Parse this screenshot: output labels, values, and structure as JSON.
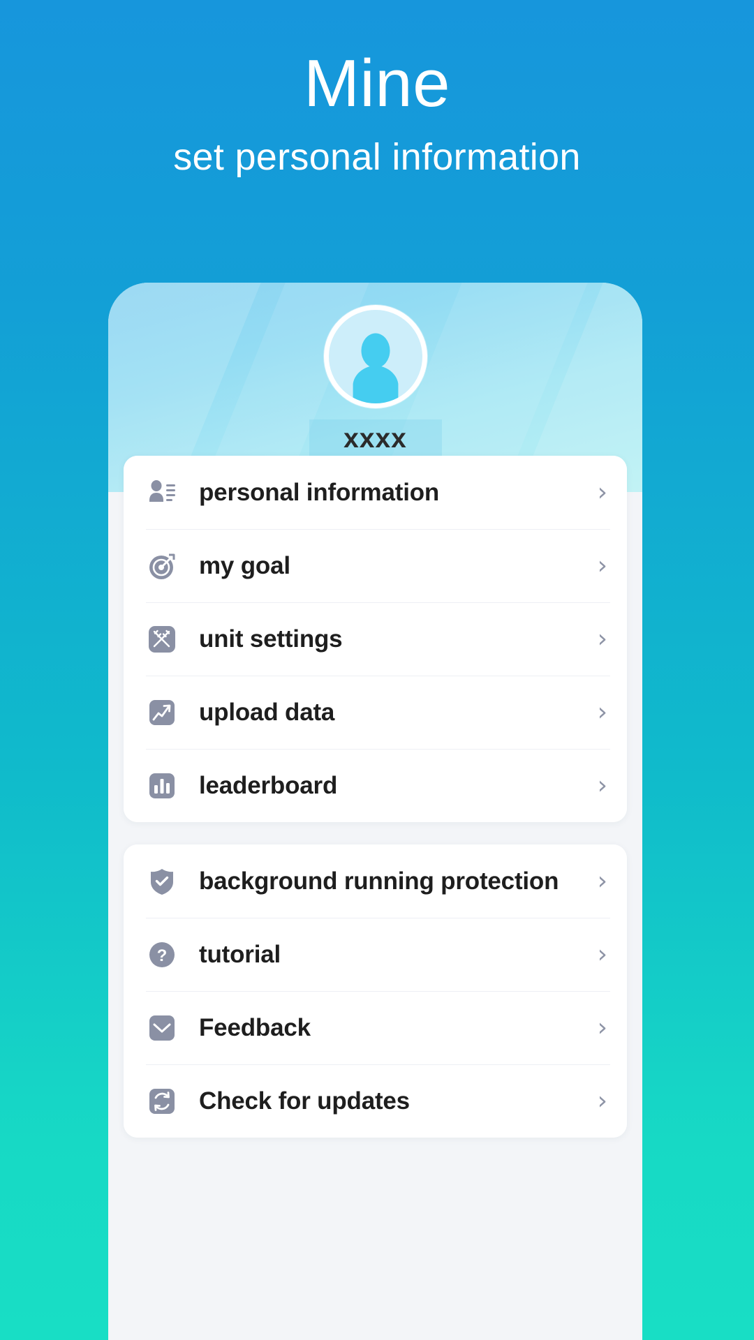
{
  "promo": {
    "title": "Mine",
    "subtitle": "set personal information"
  },
  "profile": {
    "username": "xxxx",
    "avatar_icon": "person-avatar-icon"
  },
  "colors": {
    "background_top": "#1796DC",
    "background_bottom": "#18DEC5",
    "hero_top": "#8CD3F2",
    "hero_bottom": "#B9F1F4",
    "icon_gray": "#8A90A4",
    "label_text": "#1e1e1e",
    "chevron": "#8E94A6",
    "card_background": "#FFFFFF",
    "phone_background": "#F3F5F8"
  },
  "menu_groups": [
    {
      "name": "primary",
      "items": [
        {
          "label": "personal information",
          "icon": "person-details-icon",
          "chevron": "›"
        },
        {
          "label": "my goal",
          "icon": "target-icon",
          "chevron": "›"
        },
        {
          "label": "unit settings",
          "icon": "rulers-icon",
          "chevron": "›"
        },
        {
          "label": "upload data",
          "icon": "trend-up-icon",
          "chevron": "›"
        },
        {
          "label": "leaderboard",
          "icon": "bar-chart-icon",
          "chevron": "›"
        }
      ]
    },
    {
      "name": "support",
      "items": [
        {
          "label": "background running protection",
          "icon": "shield-check-icon",
          "chevron": "›"
        },
        {
          "label": "tutorial",
          "icon": "question-circle-icon",
          "chevron": "›"
        },
        {
          "label": "Feedback",
          "icon": "envelope-icon",
          "chevron": "›"
        },
        {
          "label": "Check for updates",
          "icon": "refresh-icon",
          "chevron": "›"
        }
      ]
    }
  ]
}
